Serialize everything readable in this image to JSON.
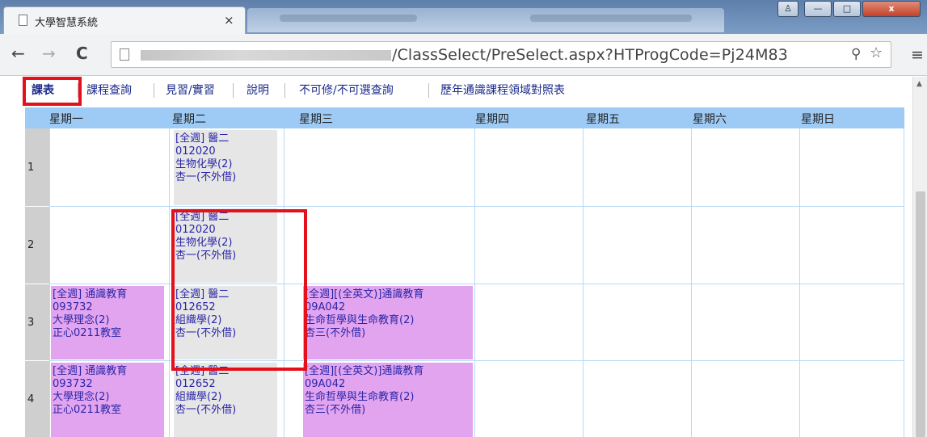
{
  "browser": {
    "tab_title": "大學智慧系統",
    "tab_close": "×",
    "url_visible": "/ClassSelect/PreSelect.aspx?HTProgCode=Pj24M83",
    "nav": {
      "back": "←",
      "forward": "→",
      "reload": "C"
    },
    "window_buttons": {
      "minimize": "—",
      "maximize": "□",
      "close": "x"
    }
  },
  "menu": {
    "items": [
      "課表",
      "課程查詢",
      "見習/實習",
      "說明",
      "不可修/不可選查詢",
      "歷年通識課程領域對照表"
    ]
  },
  "timetable": {
    "days": [
      "星期一",
      "星期二",
      "星期三",
      "星期四",
      "星期五",
      "星期六",
      "星期日"
    ],
    "periods": [
      "1",
      "2",
      "3",
      "4"
    ],
    "courses": [
      {
        "day": "星期二",
        "period": "1",
        "lines": [
          "[全週] 醫二",
          "012020",
          "生物化學(2)",
          "杏一(不外借)"
        ],
        "color": "gray"
      },
      {
        "day": "星期二",
        "period": "2",
        "lines": [
          "[全週] 醫二",
          "012020",
          "生物化學(2)",
          "杏一(不外借)"
        ],
        "color": "gray"
      },
      {
        "day": "星期一",
        "period": "3",
        "lines": [
          "[全週] 通識教育",
          "093732",
          "大學理念(2)",
          "正心0211教室"
        ],
        "color": "pink"
      },
      {
        "day": "星期二",
        "period": "3",
        "lines": [
          "[全週] 醫二",
          "012652",
          "組織學(2)",
          "杏一(不外借)"
        ],
        "color": "gray"
      },
      {
        "day": "星期三",
        "period": "3",
        "lines": [
          "[全週][(全英文)]通識教育",
          "09A042",
          "生命哲學與生命教育(2)",
          "杏三(不外借)"
        ],
        "color": "pink"
      },
      {
        "day": "星期一",
        "period": "4",
        "lines": [
          "[全週] 通識教育",
          "093732",
          "大學理念(2)",
          "正心0211教室"
        ],
        "color": "pink"
      },
      {
        "day": "星期二",
        "period": "4",
        "lines": [
          "[全週] 醫二",
          "012652",
          "組織學(2)",
          "杏一(不外借)"
        ],
        "color": "gray"
      },
      {
        "day": "星期三",
        "period": "4",
        "lines": [
          "[全週][(全英文)]通識教育",
          "09A042",
          "生命哲學與生命教育(2)",
          "杏三(不外借)"
        ],
        "color": "pink"
      }
    ]
  },
  "colors": {
    "header": "#9ecbf5",
    "highlight": "#e4101c",
    "course_gray": "#e6e6e6",
    "course_pink": "#e2a4ef"
  }
}
